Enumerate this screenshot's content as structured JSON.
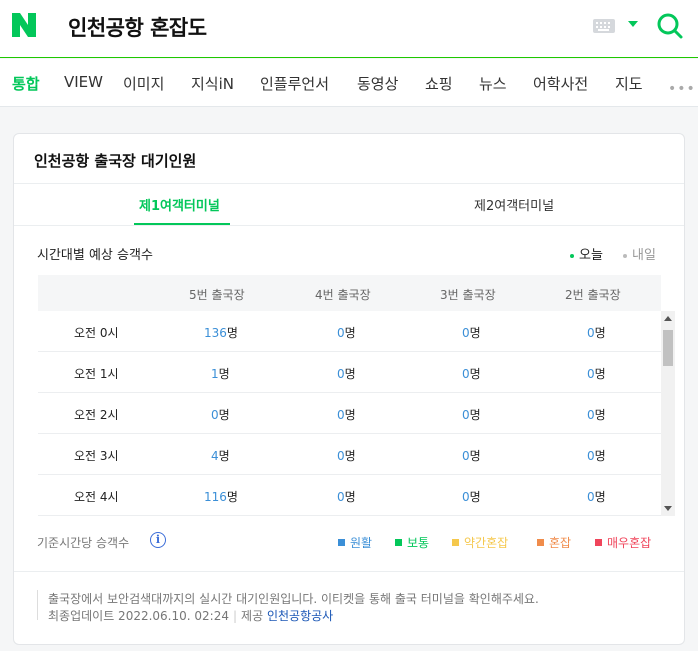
{
  "header": {
    "query": "인천공항 혼잡도",
    "brand_color": "#03c75a"
  },
  "tabs": [
    "통합",
    "VIEW",
    "이미지",
    "지식iN",
    "인플루언서",
    "동영상",
    "쇼핑",
    "뉴스",
    "어학사전",
    "지도"
  ],
  "tabs_more": "•••",
  "card": {
    "title": "인천공항 출국장 대기인원",
    "terminals": [
      "제1여객터미널",
      "제2여객터미널"
    ],
    "active_terminal": "제1여객터미널",
    "subtitle": "시간대별 예상 승객수",
    "day_options": [
      "오늘",
      "내일"
    ],
    "active_day": "오늘"
  },
  "table": {
    "columns": [
      "5번 출국장",
      "4번 출국장",
      "3번 출국장",
      "2번 출국장"
    ],
    "unit": "명",
    "rows": [
      {
        "time": "오전 0시",
        "values": [
          "136",
          "0",
          "0",
          "0"
        ]
      },
      {
        "time": "오전 1시",
        "values": [
          "1",
          "0",
          "0",
          "0"
        ]
      },
      {
        "time": "오전 2시",
        "values": [
          "0",
          "0",
          "0",
          "0"
        ]
      },
      {
        "time": "오전 3시",
        "values": [
          "4",
          "0",
          "0",
          "0"
        ]
      },
      {
        "time": "오전 4시",
        "values": [
          "116",
          "0",
          "0",
          "0"
        ]
      }
    ]
  },
  "legend": {
    "basis": "기준시간당 승객수",
    "info_icon": "i",
    "items": [
      {
        "label": "원활",
        "color": "#3b8fd7"
      },
      {
        "label": "보통",
        "color": "#03c75a"
      },
      {
        "label": "약간혼잡",
        "color": "#f5c84c"
      },
      {
        "label": "혼잡",
        "color": "#f08c4b"
      },
      {
        "label": "매우혼잡",
        "color": "#f0455b"
      }
    ]
  },
  "footer": {
    "notice": "출국장에서 보안검색대까지의 실시간 대기인원입니다. 이티켓을 통해 출국 터미널을 확인해주세요.",
    "updated_label": "최종업데이트 2022.06.10. 02:24",
    "provider_label": "제공",
    "provider": "인천공항공사"
  }
}
